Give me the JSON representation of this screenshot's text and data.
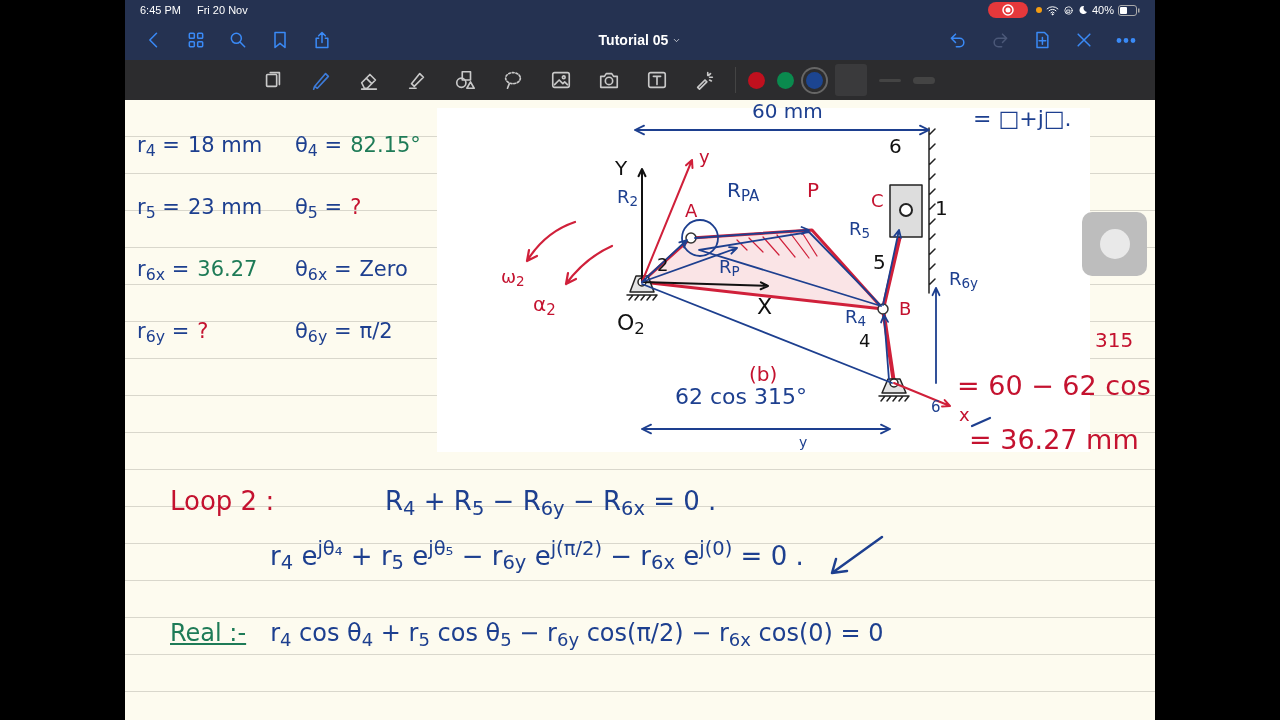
{
  "status_bar": {
    "time": "6:45 PM",
    "date": "Fri 20 Nov",
    "battery": "40%"
  },
  "nav": {
    "title": "Tutorial 05",
    "left_buttons": [
      {
        "kind": "back"
      },
      {
        "kind": "grid"
      },
      {
        "kind": "search"
      },
      {
        "kind": "bookmark"
      },
      {
        "kind": "share"
      }
    ],
    "right_buttons": [
      {
        "kind": "undo",
        "disabled": false
      },
      {
        "kind": "redo",
        "disabled": true
      },
      {
        "kind": "addpage",
        "disabled": false
      },
      {
        "kind": "close",
        "disabled": false
      },
      {
        "kind": "more",
        "disabled": false
      }
    ]
  },
  "toolbar": {
    "tools": [
      {
        "kind": "pages",
        "selected": false
      },
      {
        "kind": "pen",
        "selected": true
      },
      {
        "kind": "eraser",
        "selected": false
      },
      {
        "kind": "highlighter",
        "selected": false
      },
      {
        "kind": "shapes",
        "selected": false
      },
      {
        "kind": "lasso",
        "selected": false
      },
      {
        "kind": "image",
        "selected": false
      },
      {
        "kind": "camera",
        "selected": false
      },
      {
        "kind": "text",
        "selected": false
      },
      {
        "kind": "laser",
        "selected": false
      }
    ],
    "colors": [
      {
        "color": "#c0101e",
        "selected": false
      },
      {
        "color": "#0a8a4e",
        "selected": false
      },
      {
        "color": "#1c4591",
        "selected": true
      }
    ],
    "extras": [
      {
        "kind": "slot"
      },
      {
        "kind": "thin"
      },
      {
        "kind": "thick"
      }
    ]
  },
  "givens": [
    {
      "r": {
        "label": "r$_{4}$ =",
        "value": "18 mm",
        "color": "#1d3f8f"
      },
      "theta": {
        "label": "θ$_{4}$ =",
        "value": "82.15°",
        "color": "#1e7b57"
      }
    },
    {
      "r": {
        "label": "r$_{5}$ =",
        "value": "23 mm",
        "color": "#1d3f8f"
      },
      "theta": {
        "label": "θ$_{5}$ =",
        "value": "?",
        "color": "#c4122f"
      }
    },
    {
      "r": {
        "label": "r$_{6x}$ =",
        "value": "36.27",
        "color": "#1e7b57"
      },
      "theta": {
        "label": "θ$_{6x}$ =",
        "value": "Zero",
        "color": "#1d3f8f"
      }
    },
    {
      "r": {
        "label": "r$_{6y}$ =",
        "value": "?",
        "color": "#c4122f"
      },
      "theta": {
        "label": "θ$_{6y}$ =",
        "value": "π/2",
        "color": "#1d3f8f"
      }
    }
  ],
  "diagram": {
    "labels": [
      {
        "text": "60 mm",
        "color": "#1d3f8f"
      },
      {
        "text": "= □+j□.",
        "color": "#1d3f8f"
      },
      {
        "text": "6",
        "color": "#111111"
      },
      {
        "text": "Y",
        "color": "#111111"
      },
      {
        "text": "y",
        "color": "#c4122f"
      },
      {
        "text": "R$_{2}$",
        "color": "#1d3f8f"
      },
      {
        "text": "A",
        "color": "#c4122f"
      },
      {
        "text": "R$_{PA}$",
        "color": "#1d3f8f"
      },
      {
        "text": "P",
        "color": "#c4122f"
      },
      {
        "text": "C",
        "color": "#c4122f"
      },
      {
        "text": "1",
        "color": "#111111"
      },
      {
        "text": "R$_{5}$",
        "color": "#1d3f8f"
      },
      {
        "text": "2",
        "color": "#111111"
      },
      {
        "text": "R$_{P}$",
        "color": "#1d3f8f"
      },
      {
        "text": "5",
        "color": "#111111"
      },
      {
        "text": "ω$_{2}$",
        "color": "#c4122f"
      },
      {
        "text": "α$_{2}$",
        "color": "#c4122f"
      },
      {
        "text": "X",
        "color": "#111111"
      },
      {
        "text": "B",
        "color": "#c4122f"
      },
      {
        "text": "R$_{6y}$",
        "color": "#1d3f8f"
      },
      {
        "text": "O$_{2}$",
        "color": "#111111"
      },
      {
        "text": "R$_{4}$",
        "color": "#1d3f8f"
      },
      {
        "text": "4",
        "color": "#111111"
      },
      {
        "text": "(b)",
        "color": "#c4122f"
      },
      {
        "text": "62 cos 315°",
        "color": "#1d3f8f"
      },
      {
        "text": "6",
        "color": "#1d3f8f"
      },
      {
        "text": "x",
        "color": "#c4122f"
      },
      {
        "text": "y",
        "color": "#1d3f8f"
      },
      {
        "text": "315",
        "color": "#c4122f"
      },
      {
        "text": "= 60 − 62 cos",
        "color": "#c4122f"
      },
      {
        "text": "= 36.27 mm",
        "color": "#c4122f"
      }
    ]
  },
  "loop": {
    "label": "Loop 2 :",
    "equations": [
      "R$_{4}$ + R$_{5}$ − R$_{6y}$ − R$_{6x}$ = 0 .",
      "r$_{4}$ e$^{jθ₄}$ + r$_{5}$ e$^{jθ₅}$ − r$_{6y}$ e$^{j(π/2)}$ − r$_{6x}$ e$^{j(0)}$ = 0 ."
    ]
  },
  "real": {
    "label": "Real :-",
    "equation": "r$_{4}$ cos θ$_{4}$ + r$_{5}$ cos θ$_{5}$ − r$_{6y}$ cos(π/2) − r$_{6x}$ cos(0) = 0"
  }
}
